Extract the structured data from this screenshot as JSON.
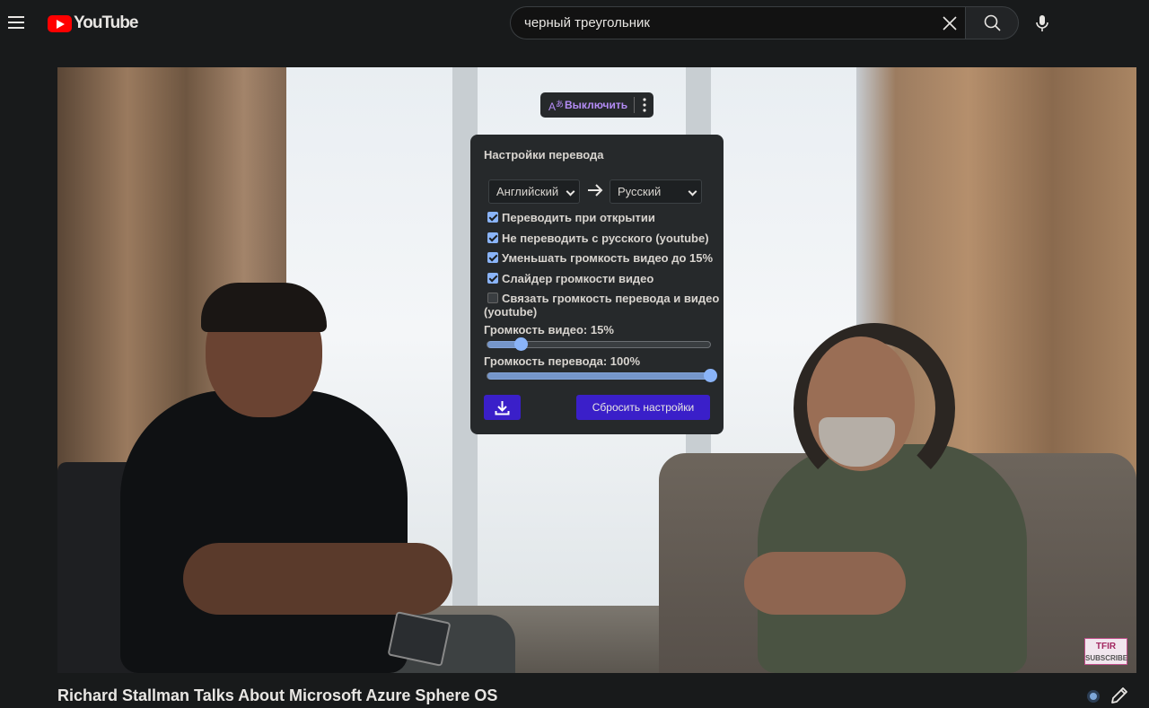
{
  "header": {
    "logo_text": "YouTube",
    "search_value": "черный треугольник",
    "icons": [
      "menu-icon",
      "youtube-logo",
      "clear-icon",
      "search-icon",
      "mic-icon"
    ]
  },
  "translator": {
    "toggle_label": "Выключить",
    "panel_title": "Настройки перевода",
    "from_lang": "Английский",
    "to_lang": "Русский",
    "options": [
      {
        "label": "Переводить при открытии",
        "checked": true
      },
      {
        "label": "Не переводить с русского (youtube)",
        "checked": true
      },
      {
        "label": "Уменьшать громкость видео до 15%",
        "checked": true
      },
      {
        "label": "Слайдер громкости видео",
        "checked": true
      },
      {
        "label": "Связать громкость перевода и видео",
        "label_cont": "(youtube)",
        "checked": false
      }
    ],
    "video_volume_label": "Громкость видео: 15%",
    "video_volume": 0.15,
    "translation_volume_label": "Громкость перевода: 100%",
    "translation_volume": 1.0,
    "reset_label": "Сбросить настройки",
    "accent_color": "#3a1fc9",
    "slider_color": "#8ab4f8"
  },
  "video": {
    "watermark_top": "TFIR",
    "watermark_bottom": "SUBSCRIBE",
    "title": "Richard Stallman Talks About Microsoft Azure Sphere OS"
  }
}
